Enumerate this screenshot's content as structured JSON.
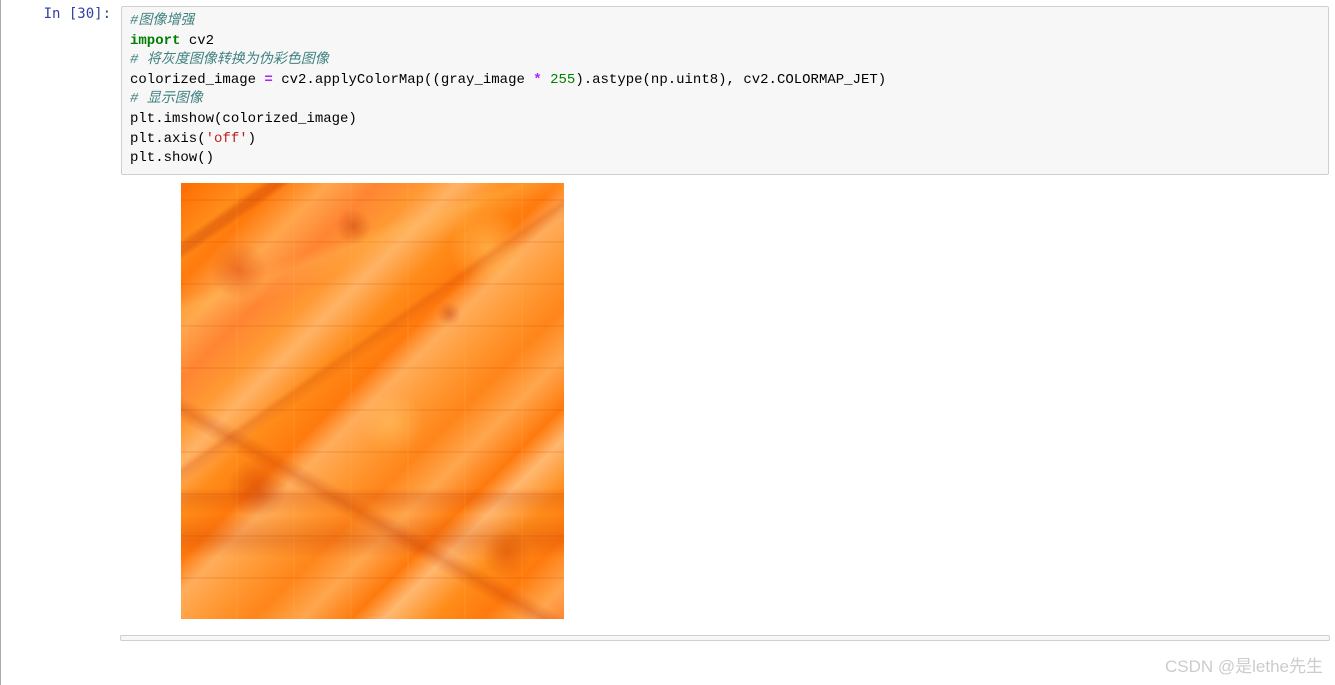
{
  "prompt": {
    "in_label": "In [30]:"
  },
  "code": {
    "line1_comment": "#图像增强",
    "line2_kw": "import",
    "line2_mod": " cv2",
    "line3_comment": "# 将灰度图像转换为伪彩色图像",
    "line4_a": "colorized_image ",
    "line4_op": "=",
    "line4_b": " cv2.applyColorMap((gray_image ",
    "line4_op2": "*",
    "line4_c": " ",
    "line4_num": "255",
    "line4_d": ").astype(np.uint8), cv2.COLORMAP_JET)",
    "line5_comment": "# 显示图像",
    "line6": "plt.imshow(colorized_image)",
    "line7_a": "plt.axis(",
    "line7_str": "'off'",
    "line7_b": ")",
    "line8": "plt.show()"
  },
  "watermark": "CSDN @是lethe先生"
}
